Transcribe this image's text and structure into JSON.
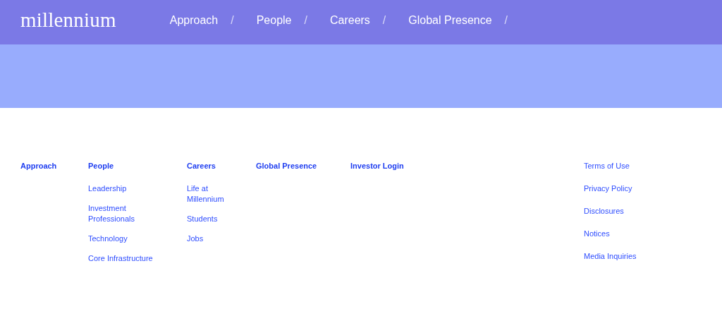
{
  "header": {
    "logo": "millennium",
    "nav": [
      {
        "label": "Approach",
        "separator": "/"
      },
      {
        "label": "People",
        "separator": "/"
      },
      {
        "label": "Careers",
        "separator": "/"
      },
      {
        "label": "Global Presence",
        "separator": "/"
      }
    ]
  },
  "footer": {
    "columns": [
      {
        "heading": "Approach"
      },
      {
        "heading": "People",
        "links": [
          "Leadership",
          "Investment Professionals",
          "Technology",
          "Core Infrastructure"
        ]
      },
      {
        "heading": "Careers",
        "links": [
          "Life at Millennium",
          "Students",
          "Jobs"
        ]
      },
      {
        "heading": "Global Presence"
      },
      {
        "heading": "Investor Login"
      }
    ],
    "legal_links": [
      "Terms of Use",
      "Privacy Policy",
      "Disclosures",
      "Notices",
      "Media Inquiries"
    ]
  }
}
